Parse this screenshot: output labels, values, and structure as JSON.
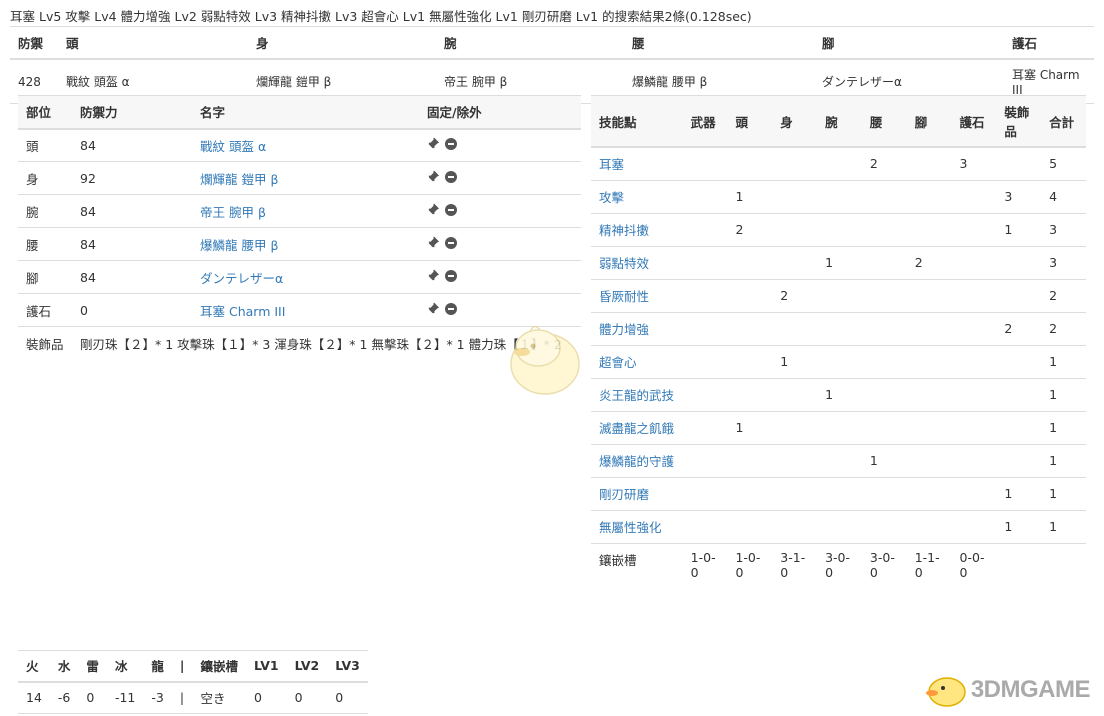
{
  "title": "耳塞 Lv5 攻擊 Lv4 體力增強 Lv2 弱點特效 Lv3 精神抖擻 Lv3 超會心 Lv1 無屬性強化 Lv1 剛刃研磨 Lv1 的搜索結果2條(0.128sec)",
  "summary": {
    "headers": [
      "防禦",
      "頭",
      "身",
      "腕",
      "腰",
      "腳",
      "護石"
    ],
    "row": [
      "428",
      "戰紋 頭盔 α",
      "爛輝龍 鎧甲 β",
      "帝王 腕甲 β",
      "爆鱗龍 腰甲 β",
      "ダンテレザーα",
      "耳塞 Charm III"
    ]
  },
  "parts": {
    "headers": [
      "部位",
      "防禦力",
      "名字",
      "固定/除外"
    ],
    "rows": [
      {
        "part": "頭",
        "def": "84",
        "name": "戰紋 頭盔 α"
      },
      {
        "part": "身",
        "def": "92",
        "name": "爛輝龍 鎧甲 β"
      },
      {
        "part": "腕",
        "def": "84",
        "name": "帝王 腕甲 β"
      },
      {
        "part": "腰",
        "def": "84",
        "name": "爆鱗龍 腰甲 β"
      },
      {
        "part": "腳",
        "def": "84",
        "name": "ダンテレザーα"
      },
      {
        "part": "護石",
        "def": "0",
        "name": "耳塞 Charm III"
      }
    ],
    "deco_label": "裝飾品",
    "deco_value": "剛刃珠【２】* 1 攻擊珠【１】* 3 渾身珠【２】* 1 無擊珠【２】* 1 體力珠【１】* 2"
  },
  "skills": {
    "headers": [
      "技能點",
      "武器",
      "頭",
      "身",
      "腕",
      "腰",
      "腳",
      "護石",
      "裝飾品",
      "合計"
    ],
    "rows": [
      {
        "name": "耳塞",
        "v": [
          "",
          "",
          "",
          "",
          "2",
          "",
          "3",
          "",
          "5"
        ]
      },
      {
        "name": "攻擊",
        "v": [
          "",
          "1",
          "",
          "",
          "",
          "",
          "",
          "3",
          "4"
        ]
      },
      {
        "name": "精神抖擻",
        "v": [
          "",
          "2",
          "",
          "",
          "",
          "",
          "",
          "1",
          "3"
        ]
      },
      {
        "name": "弱點特效",
        "v": [
          "",
          "",
          "",
          "1",
          "",
          "2",
          "",
          "",
          "3"
        ]
      },
      {
        "name": "昏厥耐性",
        "v": [
          "",
          "",
          "2",
          "",
          "",
          "",
          "",
          "",
          "2"
        ]
      },
      {
        "name": "體力增強",
        "v": [
          "",
          "",
          "",
          "",
          "",
          "",
          "",
          "2",
          "2"
        ]
      },
      {
        "name": "超會心",
        "v": [
          "",
          "",
          "1",
          "",
          "",
          "",
          "",
          "",
          "1"
        ]
      },
      {
        "name": "炎王龍的武技",
        "v": [
          "",
          "",
          "",
          "1",
          "",
          "",
          "",
          "",
          "1"
        ]
      },
      {
        "name": "滅盡龍之飢餓",
        "v": [
          "",
          "1",
          "",
          "",
          "",
          "",
          "",
          "",
          "1"
        ]
      },
      {
        "name": "爆鱗龍的守護",
        "v": [
          "",
          "",
          "",
          "",
          "1",
          "",
          "",
          "",
          "1"
        ]
      },
      {
        "name": "剛刃研磨",
        "v": [
          "",
          "",
          "",
          "",
          "",
          "",
          "",
          "1",
          "1"
        ]
      },
      {
        "name": "無屬性強化",
        "v": [
          "",
          "",
          "",
          "",
          "",
          "",
          "",
          "1",
          "1"
        ]
      }
    ],
    "slot_label": "鑲嵌槽",
    "slots": [
      "1-0-0",
      "1-0-0",
      "3-1-0",
      "3-0-0",
      "3-0-0",
      "1-1-0",
      "0-0-0",
      "",
      ""
    ]
  },
  "resist": {
    "headers": [
      "火",
      "水",
      "雷",
      "冰",
      "龍",
      "|",
      "鑲嵌槽",
      "LV1",
      "LV2",
      "LV3"
    ],
    "row": [
      "14",
      "-6",
      "0",
      "-11",
      "-3",
      "|",
      "空き",
      "0",
      "0",
      "0"
    ]
  },
  "watermark": "3DMGAME"
}
